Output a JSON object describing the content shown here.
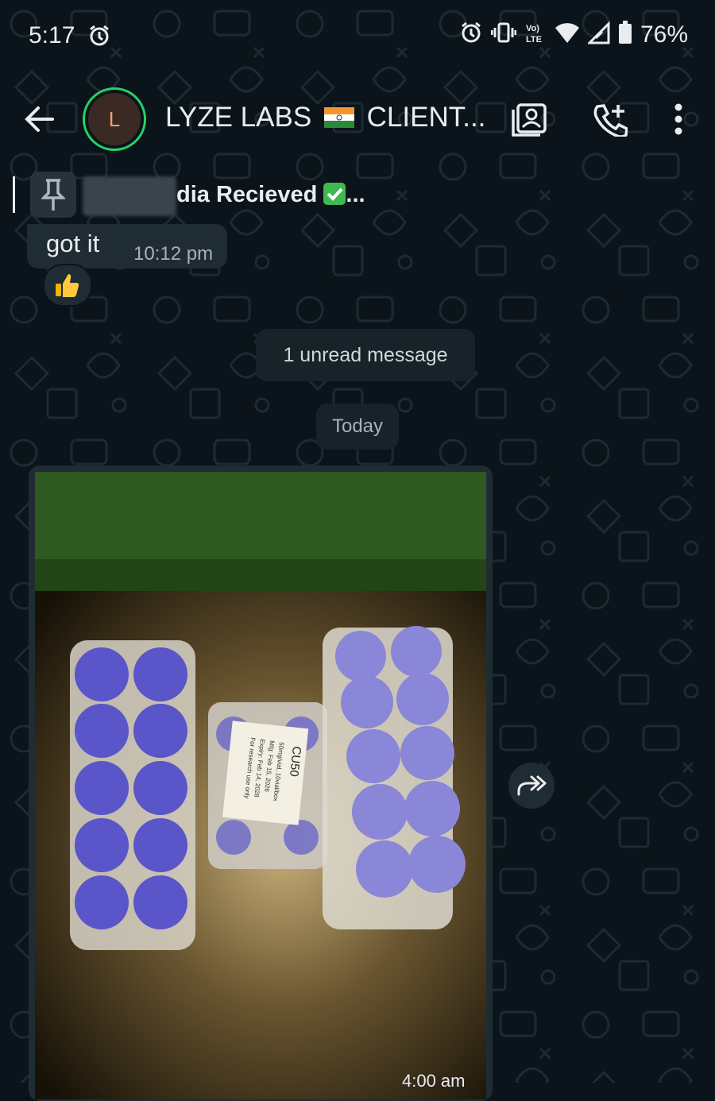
{
  "status_bar": {
    "time": "5:17",
    "battery_percent": "76%",
    "icons": [
      "alarm-icon",
      "alarm-icon",
      "vibrate-icon",
      "volte-icon",
      "wifi-icon",
      "signal-icon",
      "battery-icon"
    ]
  },
  "app_bar": {
    "avatar_letter": "L",
    "title_part1": "LYZE LABS",
    "title_part2": "CLIENT...",
    "icons": [
      "back-arrow-icon",
      "contact-card-icon",
      "add-call-icon",
      "more-vert-icon"
    ]
  },
  "pinned": {
    "text": "dia Recieved",
    "ellipsis": "..."
  },
  "messages": [
    {
      "text": "got it",
      "time": "10:12 pm",
      "reaction": "👍"
    }
  ],
  "unread_banner": "1 unread message",
  "date_divider": "Today",
  "image_message": {
    "time": "4:00 am",
    "label_title": "CU50",
    "label_lines": [
      "50mg/vial, 10vial/box",
      "Mfg: Feb 15, 2026",
      "Expiry: Feb 14, 2028",
      "For research use only"
    ]
  },
  "colors": {
    "background": "#0b141a",
    "bubble": "#202c33",
    "accent_green": "#25d366",
    "vial_cap": "#5a55c8"
  }
}
